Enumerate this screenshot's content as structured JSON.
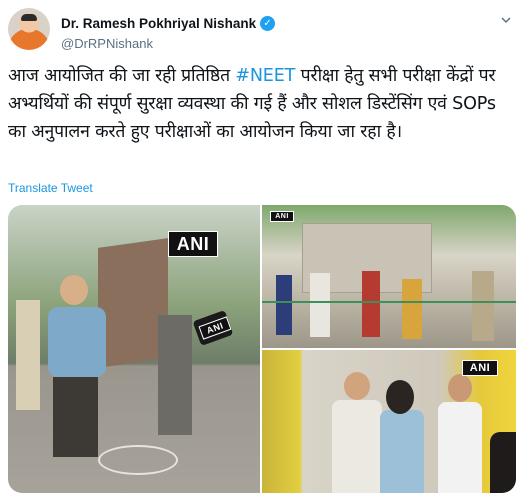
{
  "author": {
    "display_name": "Dr. Ramesh Pokhriyal Nishank",
    "handle": "@DrRPNishank",
    "verified_icon": "verified-badge-icon"
  },
  "tweet": {
    "text_before": "आज आयोजित की जा रही प्रतिष्ठित ",
    "hashtag": "#NEET",
    "text_after": " परीक्षा हेतु सभी परीक्षा केंद्रों पर अभ्यर्थियों की संपूर्ण सुरक्षा व्यवस्था की गई हैं और सोशल डिस्टेंसिंग एवं SOPs का अनुपालन करते हुए परीक्षाओं का आयोजन किया जा रहा है।",
    "translate_label": "Translate Tweet"
  },
  "media": {
    "watermarks": [
      "ANI",
      "ANI",
      "ANI"
    ],
    "mic_label": "ANI"
  },
  "colors": {
    "link": "#1b95e0",
    "verified": "#1da1f2",
    "secondary_text": "#5b7083"
  }
}
